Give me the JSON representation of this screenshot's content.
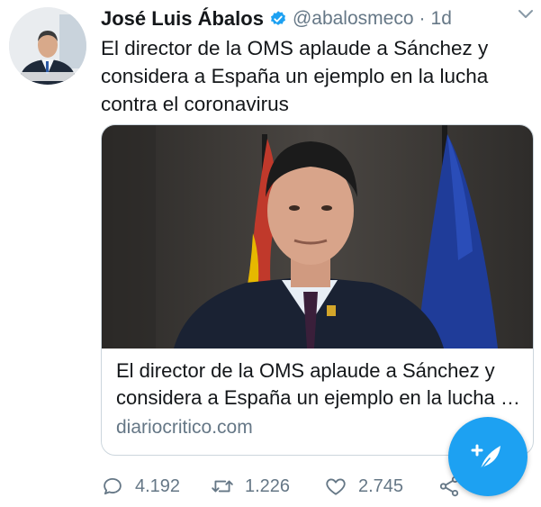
{
  "tweet": {
    "author_name": "José Luis Ábalos",
    "handle": "@abalosmeco",
    "separator": "·",
    "time": "1d",
    "text": "El director de la OMS aplaude a Sánchez y considera a España un ejemplo en la lucha contra el coronavirus",
    "verified": true
  },
  "card": {
    "title_line1": "El director de la OMS aplaude a Sánchez y",
    "title_line2": "considera a España un ejemplo en la lucha contra el coronavirus",
    "domain": "diariocritico.com"
  },
  "actions": {
    "reply_count": "4.192",
    "retweet_count": "1.226",
    "like_count": "2.745"
  },
  "icons": {
    "reply": "reply-icon",
    "retweet": "retweet-icon",
    "like": "heart-icon",
    "share": "share-icon",
    "compose": "compose-tweet-icon",
    "menu": "chevron-down-icon",
    "verified": "verified-badge-icon"
  },
  "colors": {
    "accent": "#1da1f2",
    "text": "#14171a",
    "secondary": "#657786",
    "border": "#ccd6dd"
  }
}
